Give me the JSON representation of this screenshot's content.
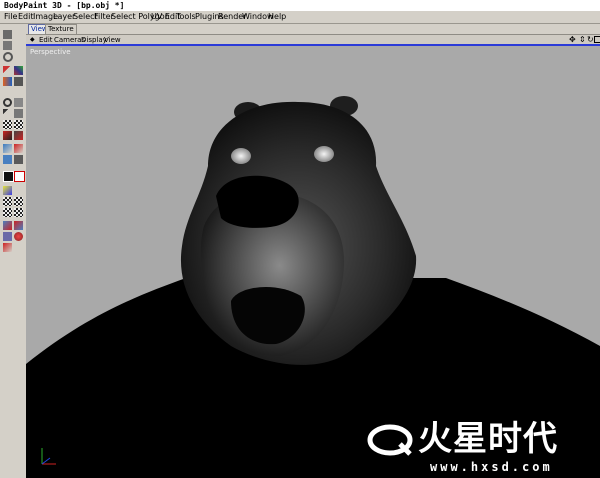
{
  "window": {
    "title": "BodyPaint 3D - [bp.obj *]"
  },
  "menubar": {
    "items": [
      "File",
      "Edit",
      "Image",
      "Layer",
      "Select",
      "Filter",
      "Select Polygon",
      "UV Edit",
      "Tools",
      "Plugins",
      "Render",
      "Window",
      "Help"
    ]
  },
  "tabs": [
    {
      "label": "View",
      "active": true
    },
    {
      "label": "Texture",
      "active": false
    }
  ],
  "viewport_menu": {
    "items": [
      "Edit",
      "Cameras",
      "Display",
      "View"
    ]
  },
  "viewport": {
    "label": "Perspective",
    "background": "#a9a9a9",
    "accent": "#2b3bd8"
  },
  "watermark": {
    "brand": "火星时代",
    "url": "www.hxsd.com"
  }
}
